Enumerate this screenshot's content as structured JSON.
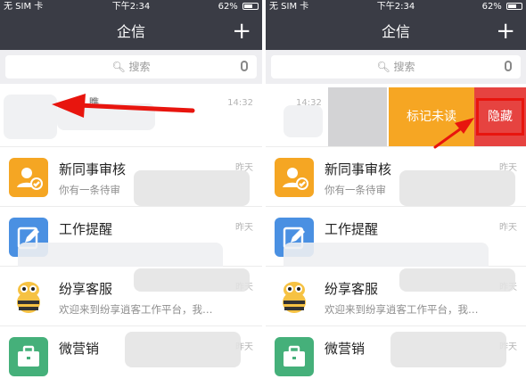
{
  "status": {
    "carrier": "无 SIM 卡",
    "time": "下午2:34",
    "battery": "62%",
    "battery_level": 0.62
  },
  "nav": {
    "title": "企信",
    "add_glyph": "+"
  },
  "search": {
    "placeholder": "搜索"
  },
  "first_row": {
    "name": "瞧",
    "time": "14:32"
  },
  "swipe_actions": {
    "mark_unread": "标记未读",
    "hide": "隐藏"
  },
  "conversations": [
    {
      "title": "新同事审核",
      "preview": "你有一条待审",
      "time": "昨天",
      "icon": "user-check-icon",
      "color": "#f5a623"
    },
    {
      "title": "工作提醒",
      "preview": "",
      "time": "昨天",
      "icon": "edit-icon",
      "color": "#4a90e2"
    },
    {
      "title": "纷享客服",
      "preview": "欢迎来到纷享逍客工作平台，我…",
      "time": "昨天",
      "icon": "bee-mascot-icon",
      "color": "#f6c243"
    },
    {
      "title": "微营销",
      "preview": "",
      "time": "昨天",
      "icon": "briefcase-icon",
      "color": "#45b07a"
    }
  ],
  "annotation_color": "#e8150e"
}
